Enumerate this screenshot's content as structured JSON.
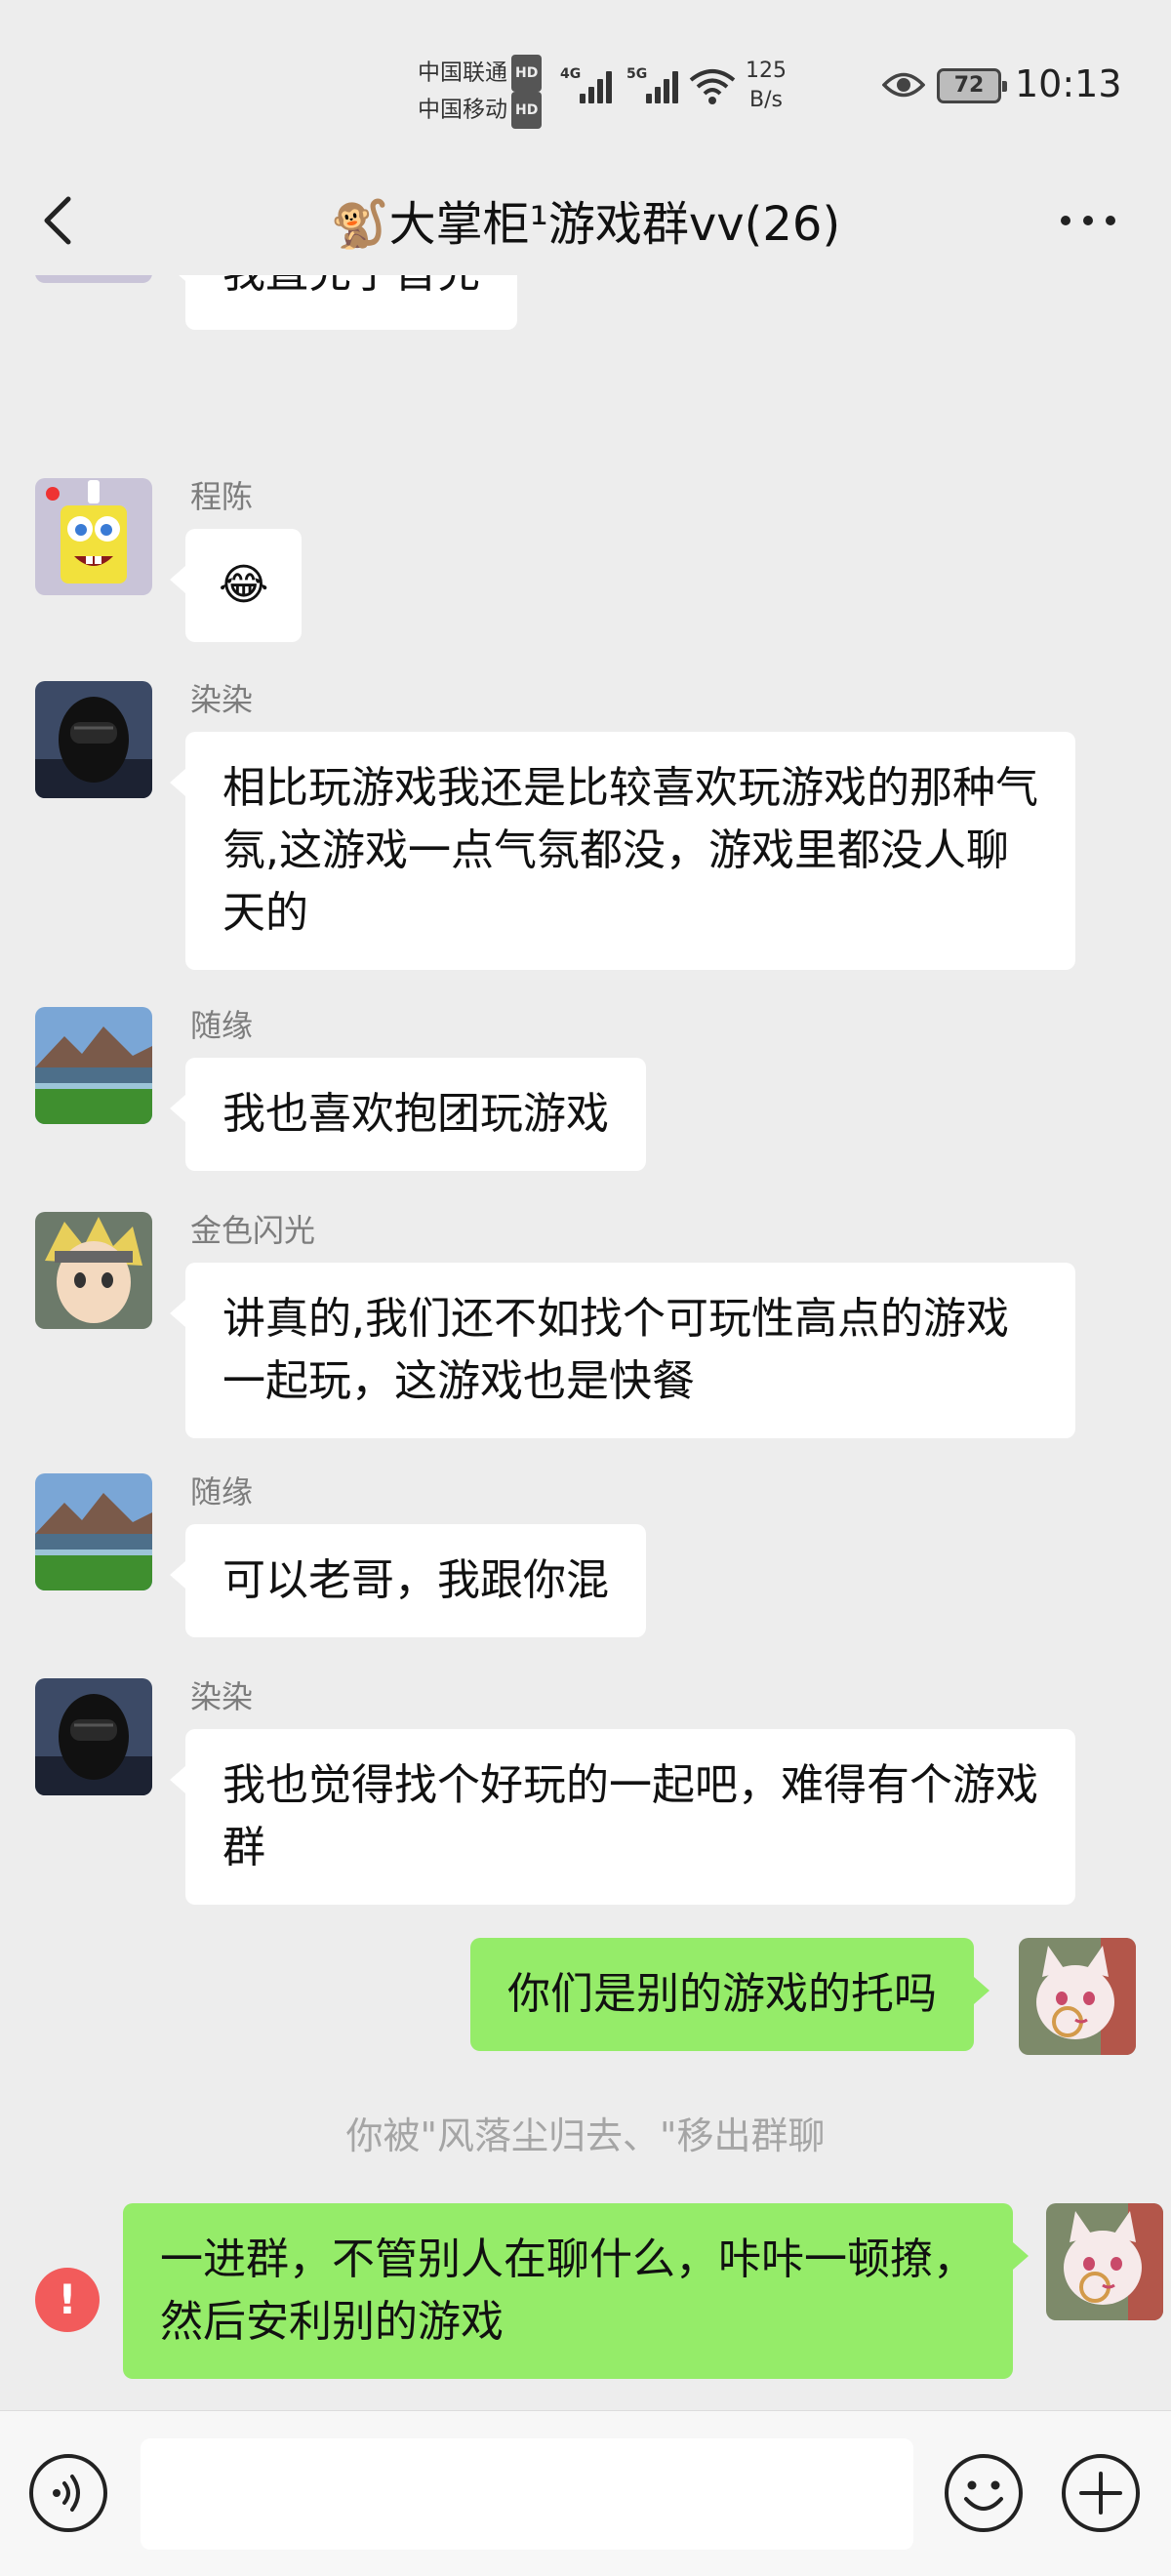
{
  "status_bar": {
    "carrier1": "中国联通",
    "carrier2": "中国移动",
    "hd_badge": "HD",
    "net1": "4G",
    "net2": "5G",
    "speed_value": "125",
    "speed_unit": "B/s",
    "battery": "72",
    "time": "10:13"
  },
  "header": {
    "title": "🐒大掌柜¹游戏群vv(26)"
  },
  "messages": [
    {
      "sender": "程陈",
      "text": "我直充了首充",
      "avatar": "spongebob-avatar"
    },
    {
      "sender": "程陈",
      "text": "😂",
      "avatar": "spongebob-avatar"
    },
    {
      "sender": "染染",
      "text": "相比玩游戏我还是比较喜欢玩游戏的那种气氛,这游戏一点气氛都没，游戏里都没人聊天的",
      "avatar": "helmet-avatar"
    },
    {
      "sender": "随缘",
      "text": "我也喜欢抱团玩游戏",
      "avatar": "landscape-avatar"
    },
    {
      "sender": "金色闪光",
      "text": "讲真的,我们还不如找个可玩性高点的游戏一起玩，这游戏也是快餐",
      "avatar": "anime-avatar"
    },
    {
      "sender": "随缘",
      "text": "可以老哥，我跟你混",
      "avatar": "landscape-avatar"
    },
    {
      "sender": "染染",
      "text": "我也觉得找个好玩的一起吧，难得有个游戏群",
      "avatar": "helmet-avatar"
    },
    {
      "sender": "",
      "text": "你们是别的游戏的托吗",
      "avatar": "fox-avatar"
    },
    {
      "sender": "",
      "text": "一进群，不管别人在聊什么，咔咔一顿撩，然后安利别的游戏",
      "avatar": "fox-avatar"
    }
  ],
  "system_message": "你被\"风落尘归去、\"移出群聊",
  "error_mark": "!",
  "icons": {
    "back": "back-arrow-icon",
    "more": "more-dots-icon",
    "voice": "voice-icon",
    "emoji": "emoji-icon",
    "plus": "plus-icon"
  }
}
